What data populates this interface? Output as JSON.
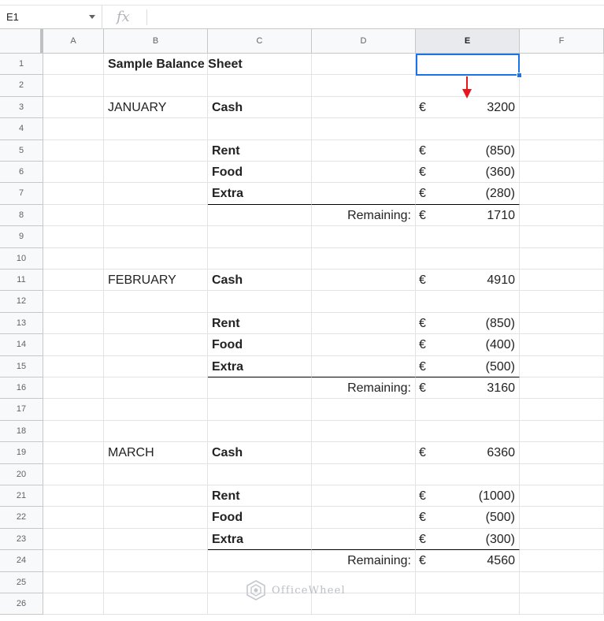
{
  "formula_bar": {
    "name_box": "E1",
    "fx_label": "fx",
    "formula": ""
  },
  "columns": [
    "A",
    "B",
    "C",
    "D",
    "E",
    "F"
  ],
  "selected_column": "E",
  "rows": [
    {
      "n": "1",
      "B": "Sample Balance Sheet"
    },
    {
      "n": "2"
    },
    {
      "n": "3",
      "B": "JANUARY",
      "C": "Cash",
      "E_sym": "€",
      "E": "3200"
    },
    {
      "n": "4"
    },
    {
      "n": "5",
      "C": "Rent",
      "E_sym": "€",
      "E": "(850)"
    },
    {
      "n": "6",
      "C": "Food",
      "E_sym": "€",
      "E": "(360)"
    },
    {
      "n": "7",
      "C": "Extra",
      "E_sym": "€",
      "E": "(280)"
    },
    {
      "n": "8",
      "D": "Remaining:",
      "E_sym": "€",
      "E": "1710"
    },
    {
      "n": "9"
    },
    {
      "n": "10"
    },
    {
      "n": "11",
      "B": "FEBRUARY",
      "C": "Cash",
      "E_sym": "€",
      "E": "4910"
    },
    {
      "n": "12"
    },
    {
      "n": "13",
      "C": "Rent",
      "E_sym": "€",
      "E": "(850)"
    },
    {
      "n": "14",
      "C": "Food",
      "E_sym": "€",
      "E": "(400)"
    },
    {
      "n": "15",
      "C": "Extra",
      "E_sym": "€",
      "E": "(500)"
    },
    {
      "n": "16",
      "D": "Remaining:",
      "E_sym": "€",
      "E": "3160"
    },
    {
      "n": "17"
    },
    {
      "n": "18"
    },
    {
      "n": "19",
      "B": "MARCH",
      "C": "Cash",
      "E_sym": "€",
      "E": "6360"
    },
    {
      "n": "20"
    },
    {
      "n": "21",
      "C": "Rent",
      "E_sym": "€",
      "E": "(1000)"
    },
    {
      "n": "22",
      "C": "Food",
      "E_sym": "€",
      "E": "(500)"
    },
    {
      "n": "23",
      "C": "Extra",
      "E_sym": "€",
      "E": "(300)"
    },
    {
      "n": "24",
      "D": "Remaining:",
      "E_sym": "€",
      "E": "4560"
    },
    {
      "n": "25"
    },
    {
      "n": "26"
    }
  ],
  "watermark": "OfficeWheel",
  "colors": {
    "selection": "#1a73e8",
    "arrow": "#e8161b"
  }
}
